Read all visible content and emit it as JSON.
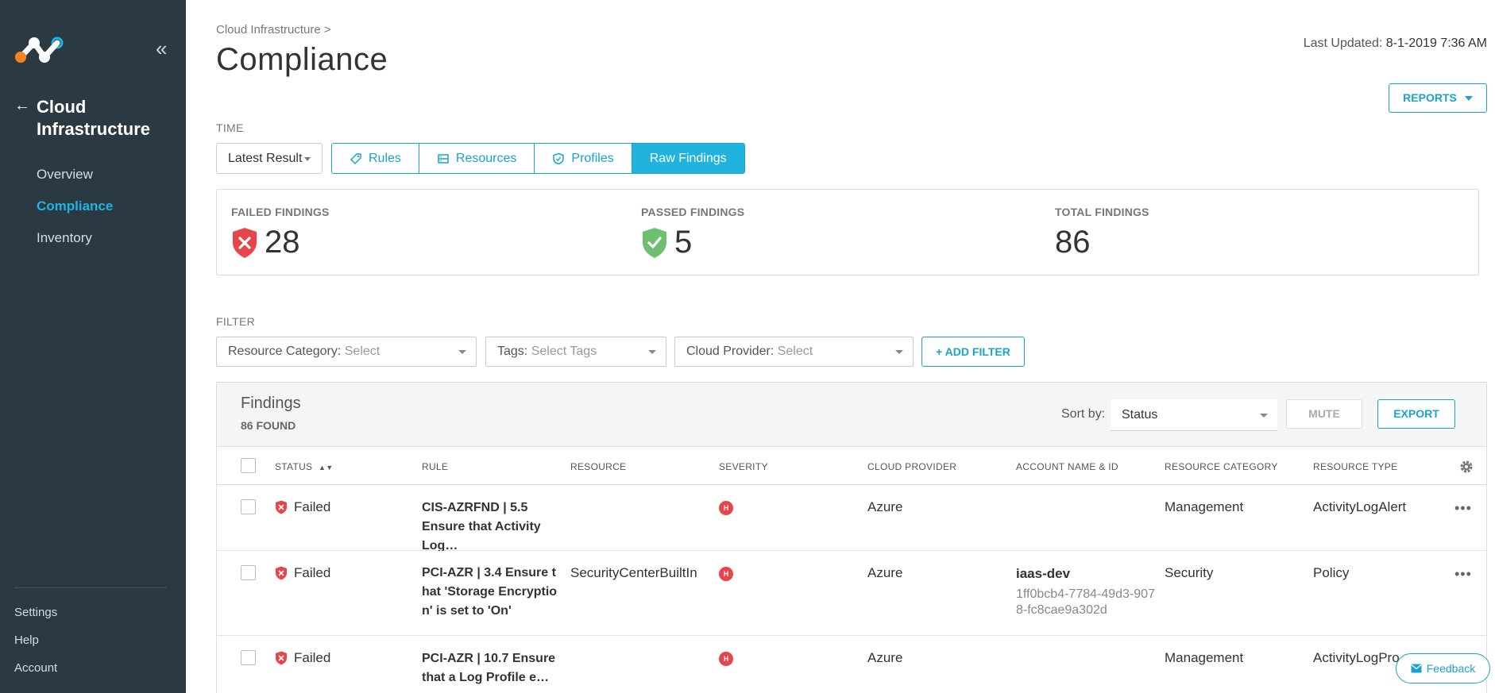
{
  "sidebar": {
    "title": "Cloud Infrastructure",
    "nav": [
      {
        "label": "Overview",
        "active": false
      },
      {
        "label": "Compliance",
        "active": true
      },
      {
        "label": "Inventory",
        "active": false
      }
    ],
    "bottom": [
      "Settings",
      "Help",
      "Account"
    ]
  },
  "header": {
    "breadcrumb": "Cloud Infrastructure >",
    "title": "Compliance",
    "last_updated_label": "Last Updated:",
    "last_updated_value": "8-1-2019 7:36 AM",
    "reports_label": "REPORTS"
  },
  "time": {
    "label": "TIME",
    "select_value": "Latest Result",
    "tabs": [
      {
        "label": "Rules",
        "icon": "tag-icon",
        "active": false
      },
      {
        "label": "Resources",
        "icon": "server-icon",
        "active": false
      },
      {
        "label": "Profiles",
        "icon": "shield-outline-icon",
        "active": false
      },
      {
        "label": "Raw Findings",
        "icon": "",
        "active": true
      }
    ]
  },
  "stats": {
    "failed": {
      "label": "FAILED FINDINGS",
      "value": "28"
    },
    "passed": {
      "label": "PASSED FINDINGS",
      "value": "5"
    },
    "total": {
      "label": "TOTAL FINDINGS",
      "value": "86"
    }
  },
  "filter": {
    "label": "FILTER",
    "dropdowns": [
      {
        "key": "Resource Category:",
        "value": "Select"
      },
      {
        "key": "Tags:",
        "value": "Select Tags"
      },
      {
        "key": "Cloud Provider:",
        "value": "Select"
      }
    ],
    "add_label": "+ ADD FILTER"
  },
  "findings": {
    "title": "Findings",
    "count": "86 FOUND",
    "sort_label": "Sort by:",
    "sort_value": "Status",
    "mute_label": "MUTE",
    "export_label": "EXPORT",
    "columns": [
      "STATUS",
      "RULE",
      "RESOURCE",
      "SEVERITY",
      "CLOUD PROVIDER",
      "ACCOUNT NAME & ID",
      "RESOURCE CATEGORY",
      "RESOURCE TYPE"
    ],
    "rows": [
      {
        "status": "Failed",
        "rule": "CIS-AZRFND | 5.5 Ensure that Activity Log…",
        "resource": "",
        "severity": "H",
        "provider": "Azure",
        "account_name": "",
        "account_id": "",
        "category": "Management",
        "type": "ActivityLogAlert"
      },
      {
        "status": "Failed",
        "rule": "PCI-AZR | 3.4 Ensure that 'Storage Encryption' is set to 'On'",
        "resource": "SecurityCenterBuiltIn",
        "severity": "H",
        "provider": "Azure",
        "account_name": "iaas-dev",
        "account_id": "1ff0bcb4-7784-49d3-9078-fc8cae9a302d",
        "category": "Security",
        "type": "Policy"
      },
      {
        "status": "Failed",
        "rule": "PCI-AZR | 10.7 Ensure that a Log Profile e…",
        "resource": "",
        "severity": "H",
        "provider": "Azure",
        "account_name": "",
        "account_id": "",
        "category": "Management",
        "type": "ActivityLogPro…"
      }
    ]
  },
  "feedback_label": "Feedback",
  "colors": {
    "sidebar_bg": "#2b3a42",
    "accent": "#1aa3cc",
    "failed": "#e8454a",
    "passed": "#6cc070"
  }
}
